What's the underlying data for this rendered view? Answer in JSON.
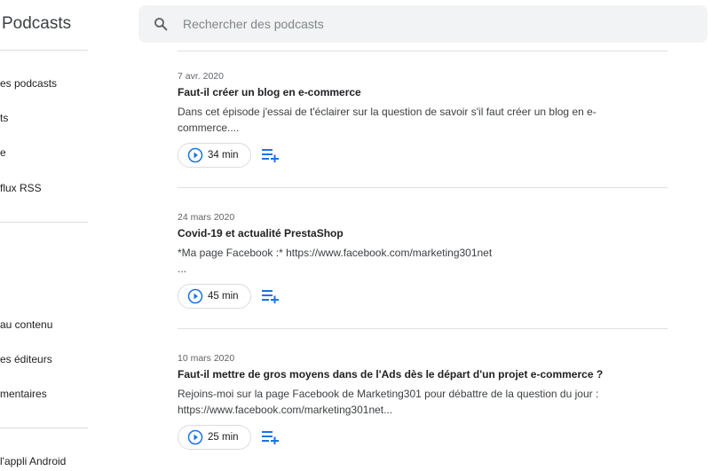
{
  "app": {
    "title": "Podcasts"
  },
  "sidebar": {
    "items": [
      {
        "label": "es podcasts"
      },
      {
        "label": "ts"
      },
      {
        "label": "e"
      },
      {
        "label": "flux RSS"
      },
      {
        "label": "au contenu"
      },
      {
        "label": "es éditeurs"
      },
      {
        "label": "mentaires"
      },
      {
        "label": "l'appli Android"
      }
    ]
  },
  "search": {
    "placeholder": "Rechercher des podcasts",
    "icon": "search-icon"
  },
  "episodes": [
    {
      "date": "7 avr. 2020",
      "title": "Faut-il créer un blog en e-commerce",
      "description_lines": [
        "Dans cet épisode j'essai de t'éclairer sur la question de savoir s'il faut créer un blog en e-",
        "commerce...."
      ],
      "duration": "34 min"
    },
    {
      "date": "24 mars 2020",
      "title": "Covid-19 et actualité PrestaShop",
      "description_lines": [
        "*Ma page Facebook :* https://www.facebook.com/marketing301net",
        "..."
      ],
      "duration": "45 min"
    },
    {
      "date": "10 mars 2020",
      "title": "Faut-il mettre de gros moyens dans de l'Ads dès le départ d'un projet e-commerce ?",
      "description_lines": [
        "Rejoins-moi sur la page Facebook de Marketing301 pour débattre de la question du jour :",
        "https://www.facebook.com/marketing301net..."
      ],
      "duration": "25 min"
    }
  ],
  "colors": {
    "accent": "#1a73e8",
    "search_bg": "#f1f3f4",
    "divider": "#e0e0e0"
  }
}
